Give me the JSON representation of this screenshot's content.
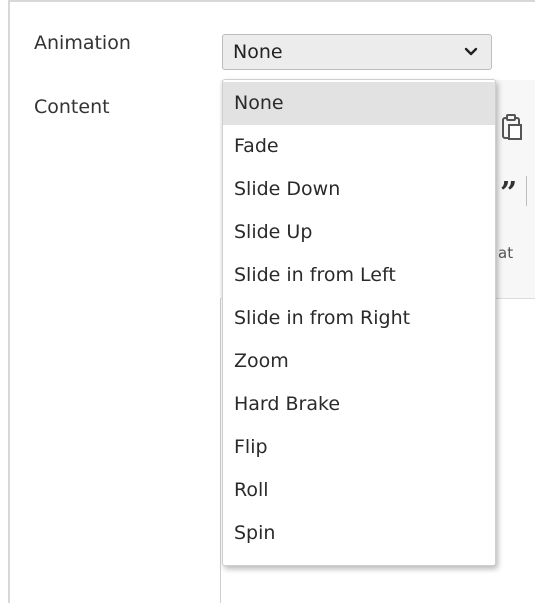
{
  "form": {
    "animation_label": "Animation",
    "content_label": "Content"
  },
  "animation_select": {
    "value": "None",
    "options": [
      "None",
      "Fade",
      "Slide Down",
      "Slide Up",
      "Slide in from Left",
      "Slide in from Right",
      "Zoom",
      "Hard Brake",
      "Flip",
      "Roll",
      "Spin"
    ],
    "highlighted": "None"
  },
  "editor": {
    "quote_glyph": "”",
    "format_fragment": "at"
  },
  "icons": {
    "select_chevron": "chevron-down-icon",
    "paste": "paste-icon"
  },
  "colors": {
    "select_bg": "#ececec",
    "highlight_bg": "#e2e2e2",
    "text": "#2a2a2a"
  }
}
